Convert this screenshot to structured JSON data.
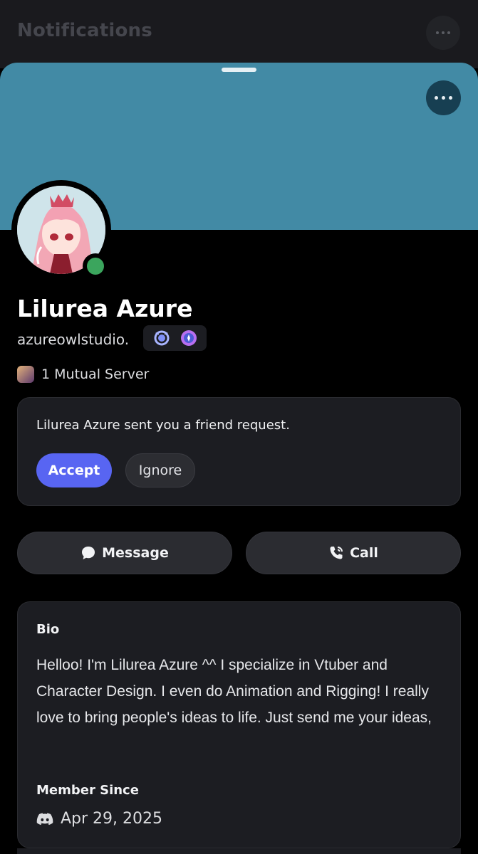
{
  "background": {
    "title": "Notifications",
    "more_icon": "more-horizontal-icon"
  },
  "profile": {
    "banner_color": "#428aa5",
    "display_name": "Lilurea Azure",
    "username": "azureowlstudio.",
    "status": "online",
    "badges": [
      "hypesquad-badge-icon",
      "nitro-boost-badge-icon"
    ],
    "mutual_servers": "1 Mutual Server"
  },
  "friend_request": {
    "text": "Lilurea Azure sent you a friend request.",
    "accept_label": "Accept",
    "ignore_label": "Ignore"
  },
  "actions": {
    "message_label": "Message",
    "call_label": "Call"
  },
  "bio": {
    "label": "Bio",
    "text": "Helloo! I'm Lilurea Azure ^^ I specialize in Vtuber and Character Design. I even do Animation and Rigging! I really love to bring people's ideas to life. Just send me your ideas,",
    "member_since_label": "Member Since",
    "member_since_date": "Apr 29, 2025"
  },
  "colors": {
    "accent": "#5865f2",
    "online": "#3ba55d",
    "card": "#1c1d22"
  }
}
